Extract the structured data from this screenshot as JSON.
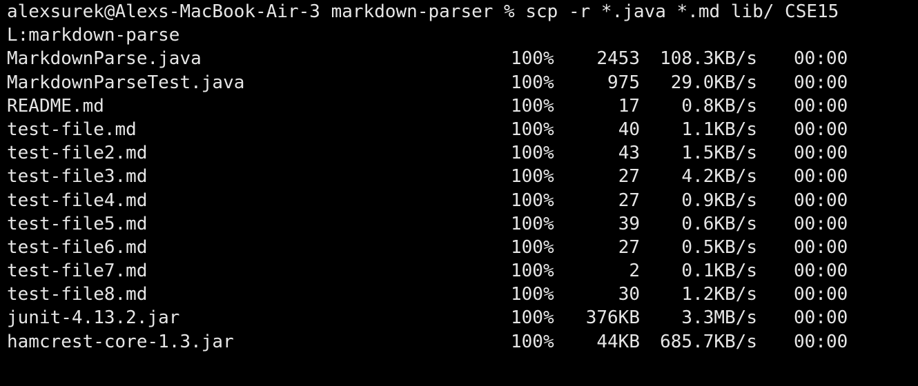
{
  "terminal": {
    "prompt_line_1": "alexsurek@Alexs-MacBook-Air-3 markdown-parser % scp -r *.java *.md lib/ CSE15",
    "prompt_line_2": "L:markdown-parse",
    "transfers": [
      {
        "file": "MarkdownParse.java",
        "percent": "100%",
        "size": "2453",
        "rate": "108.3KB/s",
        "eta": "00:00"
      },
      {
        "file": "MarkdownParseTest.java",
        "percent": "100%",
        "size": "975",
        "rate": "29.0KB/s",
        "eta": "00:00"
      },
      {
        "file": "README.md",
        "percent": "100%",
        "size": "17",
        "rate": "0.8KB/s",
        "eta": "00:00"
      },
      {
        "file": "test-file.md",
        "percent": "100%",
        "size": "40",
        "rate": "1.1KB/s",
        "eta": "00:00"
      },
      {
        "file": "test-file2.md",
        "percent": "100%",
        "size": "43",
        "rate": "1.5KB/s",
        "eta": "00:00"
      },
      {
        "file": "test-file3.md",
        "percent": "100%",
        "size": "27",
        "rate": "4.2KB/s",
        "eta": "00:00"
      },
      {
        "file": "test-file4.md",
        "percent": "100%",
        "size": "27",
        "rate": "0.9KB/s",
        "eta": "00:00"
      },
      {
        "file": "test-file5.md",
        "percent": "100%",
        "size": "39",
        "rate": "0.6KB/s",
        "eta": "00:00"
      },
      {
        "file": "test-file6.md",
        "percent": "100%",
        "size": "27",
        "rate": "0.5KB/s",
        "eta": "00:00"
      },
      {
        "file": "test-file7.md",
        "percent": "100%",
        "size": "2",
        "rate": "0.1KB/s",
        "eta": "00:00"
      },
      {
        "file": "test-file8.md",
        "percent": "100%",
        "size": "30",
        "rate": "1.2KB/s",
        "eta": "00:00"
      },
      {
        "file": "junit-4.13.2.jar",
        "percent": "100%",
        "size": "376KB",
        "rate": "3.3MB/s",
        "eta": "00:00"
      },
      {
        "file": "hamcrest-core-1.3.jar",
        "percent": "100%",
        "size": "44KB",
        "rate": "685.7KB/s",
        "eta": "00:00"
      }
    ]
  },
  "colors": {
    "background": "#000000",
    "text": "#e6e6e6"
  }
}
